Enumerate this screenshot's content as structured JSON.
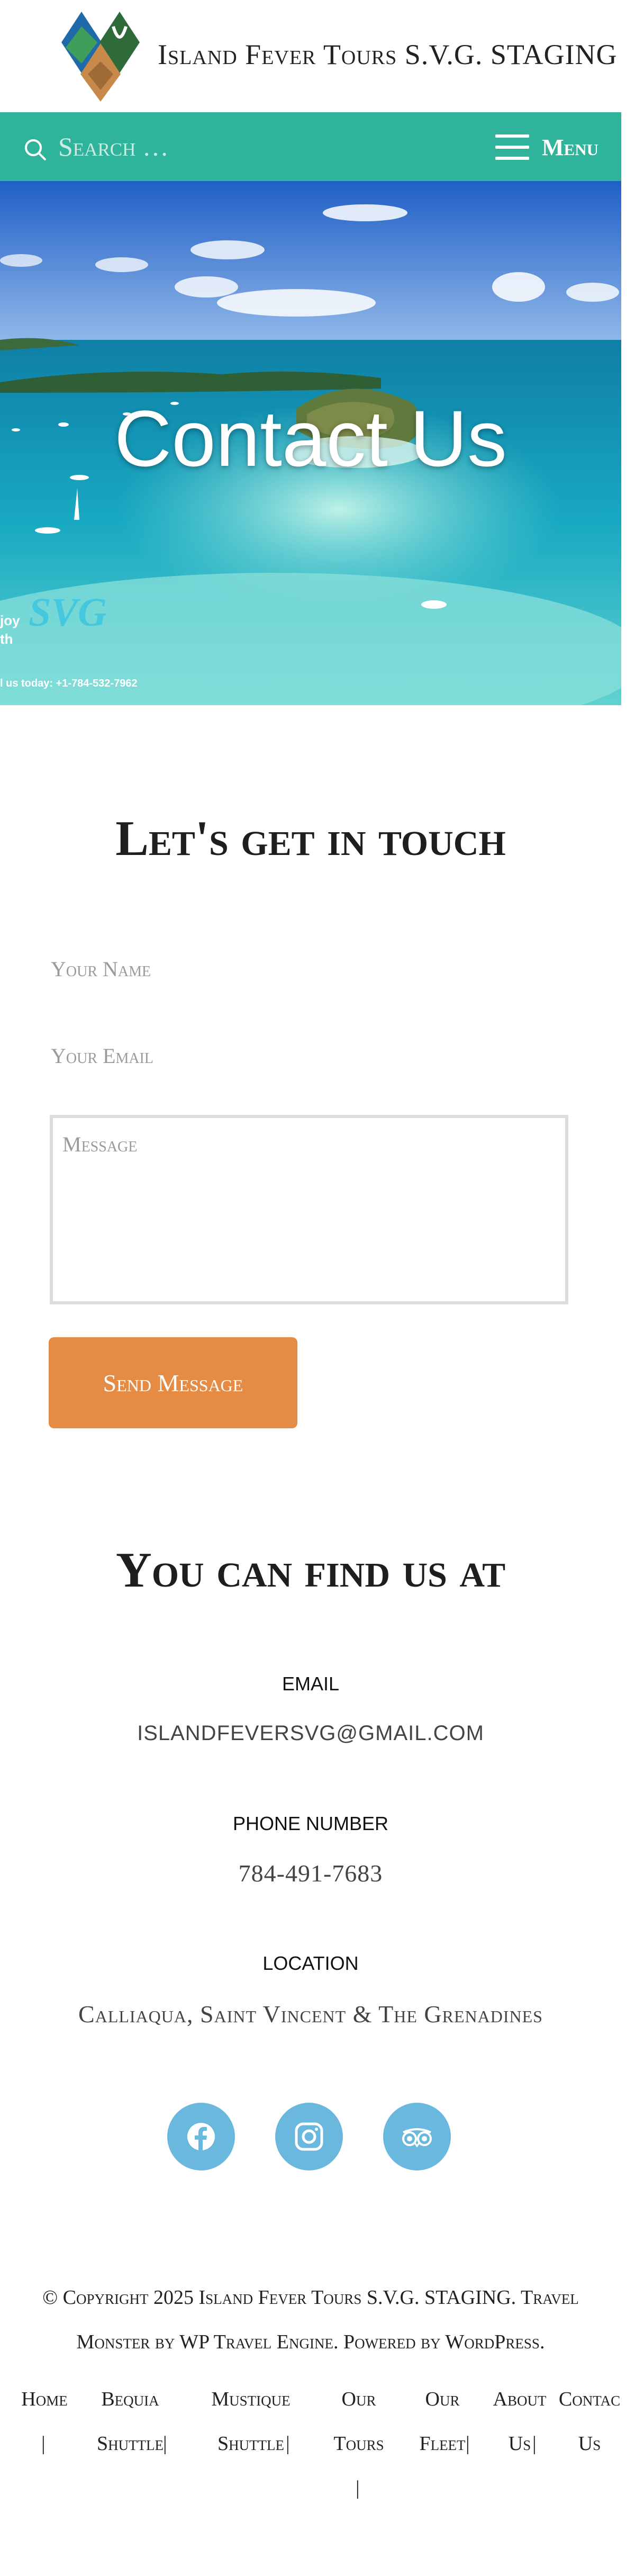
{
  "header": {
    "site_title": "Island Fever Tours S.V.G. STAGING"
  },
  "navbar": {
    "search_placeholder": "Search …",
    "menu_label": "Menu"
  },
  "hero": {
    "title": "Contact Us",
    "side_text_1": "joy",
    "side_text_2": "th",
    "logo_text": "SVG",
    "call_text": "l us today: +1-784-532-7962"
  },
  "form": {
    "heading": "Let's get in touch",
    "name_placeholder": "Your Name",
    "email_placeholder": "Your Email",
    "message_placeholder": "Message",
    "submit_label": "Send Message"
  },
  "contact": {
    "heading": "You can find us at",
    "email_label": "EMAIL",
    "email_value": "ISLANDFEVERSVG@GMAIL.COM",
    "phone_label": "PHONE NUMBER",
    "phone_value": "784-491-7683",
    "location_label": "LOCATION",
    "location_value": "Calliaqua, Saint Vincent & The Grenadines"
  },
  "social": {
    "icons": [
      "facebook-icon",
      "instagram-icon",
      "tripadvisor-icon"
    ],
    "color": "#6ab8dd"
  },
  "footer": {
    "copyright_line1": "© Copyright 2025 Island Fever Tours S.V.G. STAGING. Travel",
    "copyright_line2": "Monster by WP Travel Engine. Powered by WordPress.",
    "nav": [
      {
        "line1": "Home",
        "line2": ""
      },
      {
        "line1": "Bequia",
        "line2": "Shuttle"
      },
      {
        "line1": "Mustique",
        "line2": "Shuttle"
      },
      {
        "line1": "Our",
        "line2": "Tours"
      },
      {
        "line1": "Our",
        "line2": "Fleet"
      },
      {
        "line1": "About",
        "line2": "Us"
      },
      {
        "line1": "Contac",
        "line2": "Us"
      }
    ]
  },
  "colors": {
    "navbar": "#2fb39a",
    "button": "#e58b44",
    "social": "#6ab8dd"
  }
}
